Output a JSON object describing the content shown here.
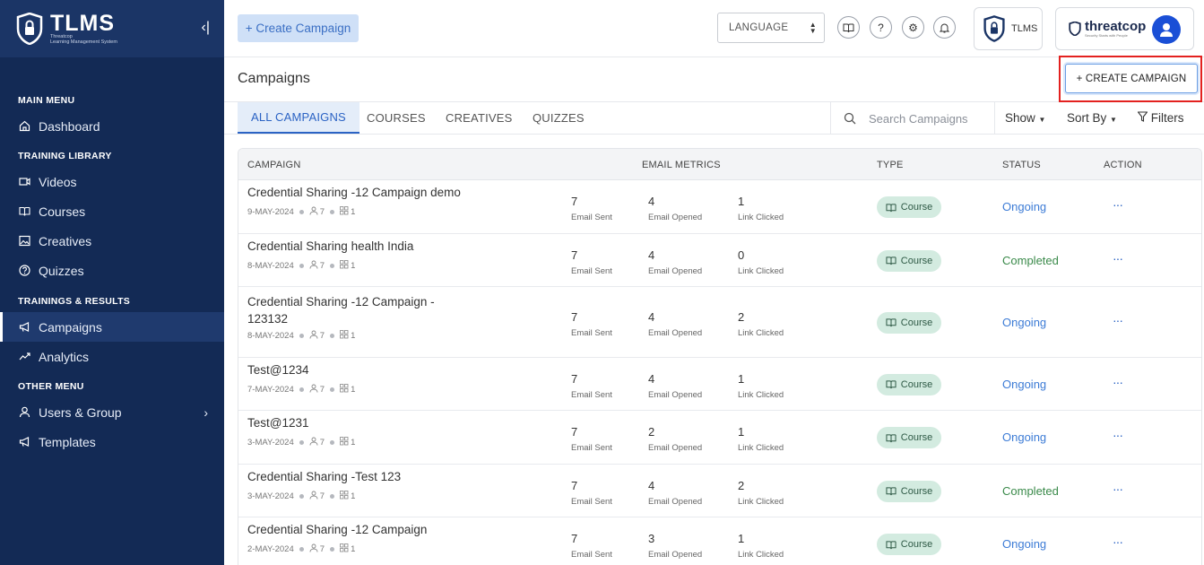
{
  "sidebar": {
    "brand_title": "TLMS",
    "brand_sub1": "Threatcop",
    "brand_sub2": "Learning Management System",
    "sections": [
      {
        "title": "MAIN MENU",
        "items": [
          {
            "label": "Dashboard",
            "icon": "home-icon"
          }
        ]
      },
      {
        "title": "TRAINING LIBRARY",
        "items": [
          {
            "label": "Videos",
            "icon": "video-icon"
          },
          {
            "label": "Courses",
            "icon": "book-icon"
          },
          {
            "label": "Creatives",
            "icon": "image-icon"
          },
          {
            "label": "Quizzes",
            "icon": "question-icon"
          }
        ]
      },
      {
        "title": "TRAININGS & RESULTS",
        "items": [
          {
            "label": "Campaigns",
            "icon": "megaphone-icon",
            "active": true
          },
          {
            "label": "Analytics",
            "icon": "chart-line-icon"
          }
        ]
      },
      {
        "title": "OTHER MENU",
        "items": [
          {
            "label": "Users & Group",
            "icon": "user-icon"
          },
          {
            "label": "Templates",
            "icon": "megaphone-icon"
          }
        ]
      }
    ]
  },
  "topbar": {
    "create_label": "+ Create Campaign",
    "language_label": "LANGUAGE",
    "tlms_label": "TLMS",
    "threatcop_label": "threatcop",
    "threatcop_tagline": "Security Starts with People"
  },
  "page": {
    "title": "Campaigns",
    "create_button": "+ CREATE CAMPAIGN"
  },
  "tabs": [
    "ALL CAMPAIGNS",
    "COURSES",
    "CREATIVES",
    "QUIZZES"
  ],
  "search": {
    "placeholder": "Search Campaigns"
  },
  "controls": {
    "show": "Show",
    "sort": "Sort By",
    "filters": "Filters"
  },
  "table": {
    "headers": {
      "campaign": "CAMPAIGN",
      "metrics": "EMAIL METRICS",
      "type": "TYPE",
      "status": "STATUS",
      "action": "ACTION"
    },
    "metric_labels": {
      "sent": "Email Sent",
      "opened": "Email Opened",
      "clicked": "Link Clicked"
    },
    "rows": [
      {
        "name": "Credential Sharing -12 Campaign demo",
        "date": "9-MAY-2024",
        "users": "7",
        "groups": "1",
        "sent": "7",
        "opened": "4",
        "clicked": "1",
        "type": "Course",
        "status": "Ongoing"
      },
      {
        "name": "Credential Sharing health India",
        "date": "8-MAY-2024",
        "users": "7",
        "groups": "1",
        "sent": "7",
        "opened": "4",
        "clicked": "0",
        "type": "Course",
        "status": "Completed"
      },
      {
        "name": "Credential Sharing -12 Campaign - 123132",
        "date": "8-MAY-2024",
        "users": "7",
        "groups": "1",
        "sent": "7",
        "opened": "4",
        "clicked": "2",
        "type": "Course",
        "status": "Ongoing"
      },
      {
        "name": "Test@1234",
        "date": "7-MAY-2024",
        "users": "7",
        "groups": "1",
        "sent": "7",
        "opened": "4",
        "clicked": "1",
        "type": "Course",
        "status": "Ongoing"
      },
      {
        "name": "Test@1231",
        "date": "3-MAY-2024",
        "users": "7",
        "groups": "1",
        "sent": "7",
        "opened": "2",
        "clicked": "1",
        "type": "Course",
        "status": "Ongoing"
      },
      {
        "name": "Credential Sharing -Test 123",
        "date": "3-MAY-2024",
        "users": "7",
        "groups": "1",
        "sent": "7",
        "opened": "4",
        "clicked": "2",
        "type": "Course",
        "status": "Completed"
      },
      {
        "name": "Credential Sharing -12 Campaign",
        "date": "2-MAY-2024",
        "users": "7",
        "groups": "1",
        "sent": "7",
        "opened": "3",
        "clicked": "1",
        "type": "Course",
        "status": "Ongoing"
      }
    ]
  },
  "colors": {
    "sidebar_bg": "#132a55",
    "accent": "#2b63c4",
    "ongoing": "#3d7cd6",
    "completed": "#3a8a4a",
    "highlight": "#e3211f"
  }
}
